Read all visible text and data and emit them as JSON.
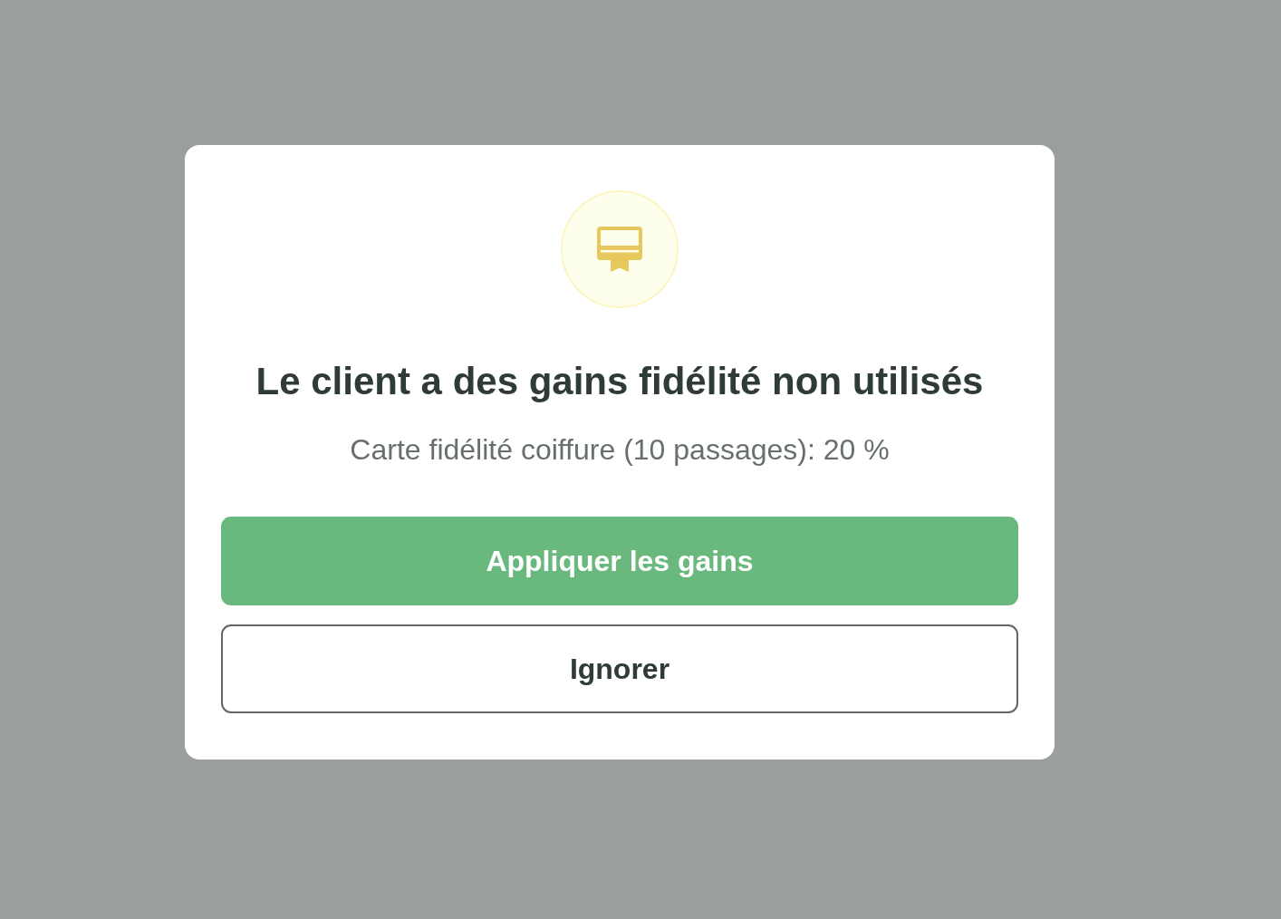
{
  "dialog": {
    "title": "Le client a des gains fidélité non utilisés",
    "message": "Carte fidélité coiffure (10 passages): 20 %",
    "buttons": [
      {
        "label": "Appliquer les gains",
        "kind": "primary"
      },
      {
        "label": "Ignorer",
        "kind": "secondary"
      }
    ]
  }
}
